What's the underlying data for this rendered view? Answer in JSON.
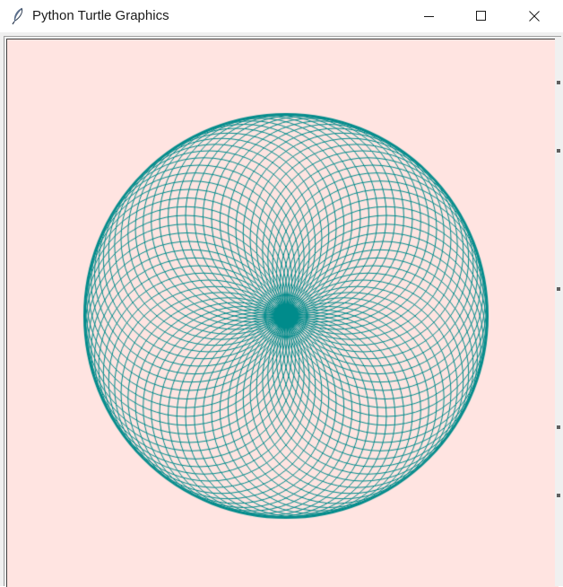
{
  "window": {
    "title": "Python Turtle Graphics",
    "icon": "feather-icon",
    "controls": {
      "minimize_icon": "minimize-icon",
      "maximize_icon": "maximize-icon",
      "close_icon": "close-icon"
    }
  },
  "canvas": {
    "background_color": "#ffe4e1",
    "pen_color": "#008b8b",
    "drawing": "spirograph",
    "circle_count": 72
  }
}
